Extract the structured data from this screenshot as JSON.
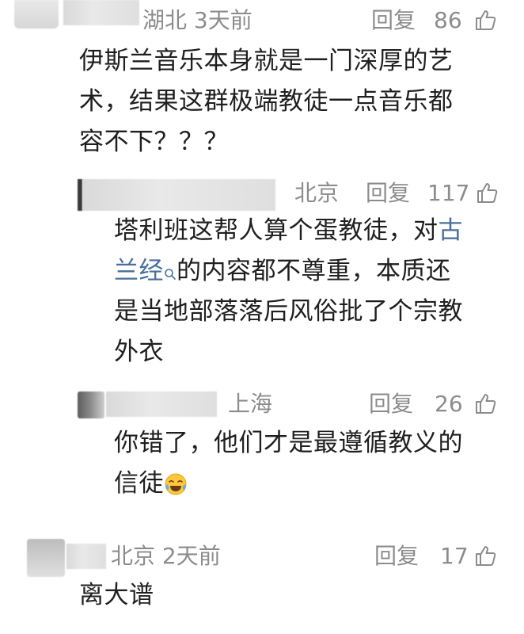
{
  "comments": [
    {
      "location_time": "湖北 3天前",
      "reply_label": "回复",
      "likes": "86",
      "text": "伊斯兰音乐本身就是一门深厚的艺术，结果这群极端教徒一点音乐都容不下？？？",
      "lines": [
        "伊斯兰音乐本身就是一门深厚的艺",
        "术，结果这群极端教徒一点音乐都",
        "容不下？？？"
      ]
    },
    {
      "location": "北京",
      "reply_label": "回复",
      "likes": "117",
      "lines": {
        "l1_pre": "塔利班这帮人算个蛋教徒，对",
        "l1_link": "古",
        "l2_link": "兰经",
        "l2_post": "的内容都不尊重，本质还",
        "l3": "是当地部落落后风俗批了个宗教",
        "l4": "外衣"
      }
    },
    {
      "location": "上海",
      "reply_label": "回复",
      "likes": "26",
      "lines": [
        "你错了，他们才是最遵循教义的",
        "信徒"
      ],
      "emoji": "face-with-tears-of-joy-emoji"
    },
    {
      "location_time": "北京 2天前",
      "reply_label": "回复",
      "likes": "17",
      "lines": [
        "离大谱"
      ]
    }
  ],
  "icons": {
    "like": "thumbs-up-outline-icon",
    "search": "search-icon"
  },
  "colors": {
    "meta": "#8c8c8c",
    "text": "#1f1f1f",
    "link": "#4a6f9d"
  }
}
